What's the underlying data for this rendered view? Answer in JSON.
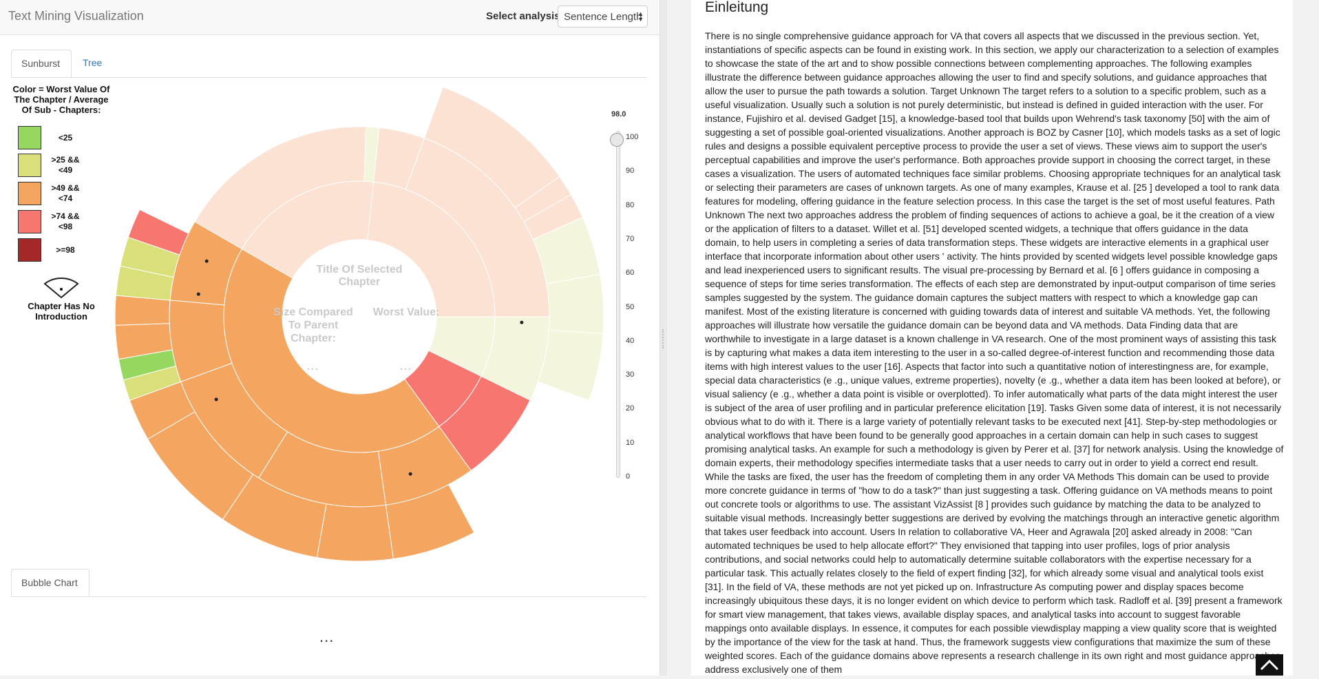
{
  "header": {
    "app_title": "Text Mining Visualization",
    "select_label": "Select analysis",
    "select_value": "Sentence Length"
  },
  "tabs": [
    {
      "label": "Sunburst",
      "active": true
    },
    {
      "label": "Tree",
      "active": false
    }
  ],
  "legend": {
    "title": "Color = Worst Value Of The Chapter / Average Of Sub - Chapters:",
    "items": [
      {
        "label": "<25",
        "color": "#95d75f"
      },
      {
        "label": ">25 && <49",
        "color": "#d9e07a"
      },
      {
        "label": ">49 && <74",
        "color": "#f4a661"
      },
      {
        "label": ">74 && <98",
        "color": "#f7766f"
      },
      {
        "label": ">=98",
        "color": "#a52828"
      }
    ],
    "no_intro_label": "Chapter Has No Introduction"
  },
  "sunburst": {
    "center_title": "Title Of Selected Chapter",
    "size_label": "Size Compared To Parent Chapter:",
    "worst_label": "Worst Value:",
    "size_value": "...",
    "worst_value": "...",
    "colors": {
      "green": "#95d75f",
      "yellow": "#d9e07a",
      "orange": "#f4a661",
      "red": "#f7766f",
      "faded_peach": "#fce2d3",
      "faded_yellow": "#f4f5dd",
      "center_text": "#c9c9c9"
    }
  },
  "slider": {
    "value_label": "98.0",
    "value": 98,
    "ticks": [
      "100",
      "90",
      "80",
      "70",
      "60",
      "50",
      "40",
      "30",
      "20",
      "10",
      "0"
    ]
  },
  "bubble": {
    "tab_label": "Bubble Chart",
    "placeholder": "..."
  },
  "document": {
    "heading": "Einleitung",
    "body": "There is no single comprehensive guidance approach for VA that covers all aspects that we discussed in the previous section. Yet, instantiations of specific aspects can be found in existing work. In this section, we apply our characterization to a selection of examples to showcase the state of the art and to show possible connections between complementing approaches. The following examples illustrate the difference between guidance approaches allowing the user to find and specify solutions, and guidance approaches that allow the user to pursue the path towards a solution. Target Unknown The target refers to a solution to a specific problem, such as a useful visualization. Usually such a solution is not purely deterministic, but instead is defined in guided interaction with the user. For instance, Fujishiro et al. devised Gadget [15], a knowledge-based tool that builds upon Wehrend's task taxonomy [50] with the aim of suggesting a set of possible goal-oriented visualizations. Another approach is BOZ by Casner [10], which models tasks as a set of logic rules and designs a possible equivalent perceptive process to provide the user a set of views. These views aim to support the user's perceptual capabilities and improve the user's performance. Both approaches provide support in choosing the correct target, in these cases a visualization. The users of automated techniques face similar problems. Choosing appropriate techniques for an analytical task or selecting their parameters are cases of unknown targets. As one of many examples, Krause et al. [25 ] developed a tool to rank data features for modeling, offering guidance in the feature selection process. In this case the target is the set of most useful features. Path Unknown The next two approaches address the problem of finding sequences of actions to achieve a goal, be it the creation of a view or the application of filters to a dataset. Willet et al. [51] developed scented widgets, a technique that offers guidance in the data domain, to help users in completing a series of data transformation steps. These widgets are interactive elements in a graphical user interface that incorporate information about other users ' activity. The hints provided by scented widgets level possible knowledge gaps and lead inexperienced users to significant results. The visual pre-processing by Bernard et al. [6 ] offers guidance in composing a sequence of steps for time series transformation. The effects of each step are demonstrated by input-output comparison of time series samples suggested by the system. The guidance domain captures the subject matters with respect to which a knowledge gap can manifest. Most of the existing literature is concerned with guiding towards data of interest and suitable VA methods. Yet, the following approaches will illustrate how versatile the guidance domain can be beyond data and VA methods. Data Finding data that are worthwhile to investigate in a large dataset is a known challenge in VA research. One of the most prominent ways of assisting this task is by capturing what makes a data item interesting to the user in a so-called degree-of-interest function and recommending those data items with high interest values to the user [16]. Aspects that factor into such a quantitative notion of interestingness are, for example, special data characteristics (e .g., unique values, extreme properties), novelty (e .g., whether a data item has been looked at before), or visual saliency (e .g., whether a data point is visible or overplotted). To infer automatically what parts of the data might interest the user is subject of the area of user profiling and in particular preference elicitation [19]. Tasks Given some data of interest, it is not necessarily obvious what to do with it. There is a large variety of potentially relevant tasks to be executed next [41]. Step-by-step methodologies or analytical workflows that have been found to be generally good approaches in a certain domain can help in such cases to suggest promising analytical tasks. An example for such a methodology is given by Perer et al. [37] for network analysis. Using the knowledge of domain experts, their methodology specifies intermediate tasks that a user needs to carry out in order to yield a correct end result. While the tasks are fixed, the user has the freedom of completing them in any order VA Methods This domain can be used to provide more concrete guidance in terms of \"how to do a task?\" than just suggesting a task. Offering guidance on VA methods means to point out concrete tools or algorithms to use. The assistant VizAssist [8 ] provides such guidance by matching the data to be analyzed to suitable visual methods. Increasingly better suggestions are derived by evolving the matchings through an interactive genetic algorithm that takes user feedback into account. Users In relation to collaborative VA, Heer and Agrawala [20] asked already in 2008: \"Can automated techniques be used to help allocate effort?\" They envisioned that tapping into user profiles, logs of prior analysis contributions, and social networks could help to automatically determine suitable collaborators with the expertise necessary for a particular task. This actually relates closely to the field of expert finding [32], for which already some visual and analytical tools exist [31]. In the field of VA, these methods are not yet picked up on. Infrastructure As computing power and display spaces become increasingly ubiquitous these days, it is no longer evident on which device to perform which task. Radloff et al. [39] present a framework for smart view management, that takes views, available display spaces, and analytical tasks into account to suggest favorable mappings onto available displays. In essence, it computes for each possible viewdisplay mapping a view quality score that is weighted by the importance of the view for the task at hand. Thus, the framework suggests view configurations that maximize the sum of these weighted scores. Each of the guidance domains above represents a research challenge in its own right and most guidance approaches address exclusively one of them"
  }
}
